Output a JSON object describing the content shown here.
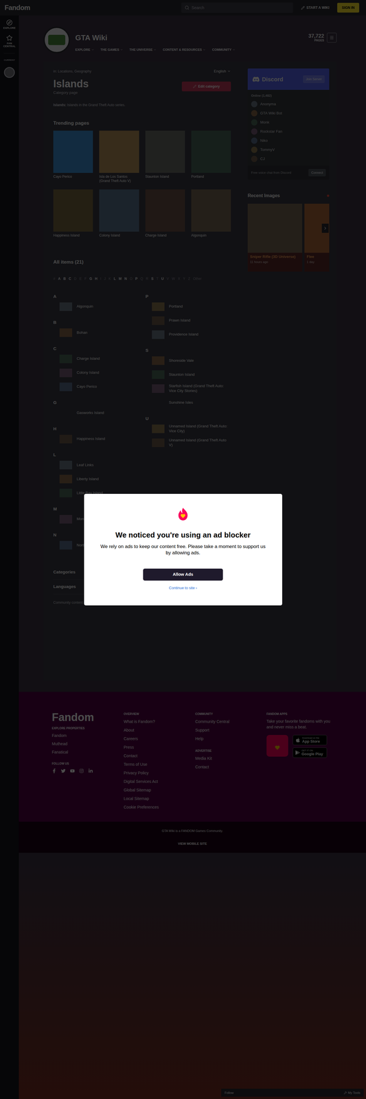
{
  "global_nav": {
    "logo": "Fandom",
    "search_placeholder": "Search",
    "start_wiki": "START A WIKI",
    "sign_in": "SIGN IN"
  },
  "left_rail": {
    "items": [
      "EXPLORE",
      "FAN CENTRAL"
    ],
    "current_label": "CURRENT"
  },
  "wiki": {
    "name": "GTA Wiki",
    "nav": [
      "EXPLORE",
      "THE GAMES",
      "THE UNIVERSE",
      "CONTENT & RESOURCES",
      "COMMUNITY"
    ],
    "pages_count": "37,722",
    "pages_label": "PAGES"
  },
  "page": {
    "breadcrumb": "in: Locations, Geography",
    "language": "English",
    "title": "Islands",
    "subtitle": "Category page",
    "edit_button": "Edit category",
    "description_label": "Islands:",
    "description": "Islands in the Grand Theft Auto series."
  },
  "trending": {
    "title": "Trending pages",
    "items": [
      "Cayo Perico",
      "Isla de Los Santos (Grand Theft Auto V)",
      "Staunton Island",
      "Portland",
      "Happiness Island",
      "Colony Island",
      "Charge Island",
      "Algonquin"
    ]
  },
  "all_items": {
    "title": "All items (21)",
    "alphabet": [
      {
        "letter": "#",
        "has_items": false
      },
      {
        "letter": "A",
        "has_items": true
      },
      {
        "letter": "B",
        "has_items": true
      },
      {
        "letter": "C",
        "has_items": true
      },
      {
        "letter": "D",
        "has_items": false
      },
      {
        "letter": "E",
        "has_items": false
      },
      {
        "letter": "F",
        "has_items": false
      },
      {
        "letter": "G",
        "has_items": true
      },
      {
        "letter": "H",
        "has_items": true
      },
      {
        "letter": "I",
        "has_items": false
      },
      {
        "letter": "J",
        "has_items": false
      },
      {
        "letter": "K",
        "has_items": false
      },
      {
        "letter": "L",
        "has_items": true
      },
      {
        "letter": "M",
        "has_items": true
      },
      {
        "letter": "N",
        "has_items": true
      },
      {
        "letter": "O",
        "has_items": false
      },
      {
        "letter": "P",
        "has_items": true
      },
      {
        "letter": "Q",
        "has_items": false
      },
      {
        "letter": "R",
        "has_items": false
      },
      {
        "letter": "S",
        "has_items": true
      },
      {
        "letter": "T",
        "has_items": false
      },
      {
        "letter": "U",
        "has_items": true
      },
      {
        "letter": "V",
        "has_items": false
      },
      {
        "letter": "W",
        "has_items": false
      },
      {
        "letter": "X",
        "has_items": false
      },
      {
        "letter": "Y",
        "has_items": false
      },
      {
        "letter": "Z",
        "has_items": false
      },
      {
        "letter": "Other",
        "has_items": false
      }
    ],
    "columns": [
      [
        {
          "letter": "A",
          "items": [
            {
              "name": "Algonquin",
              "thumbnail": true
            }
          ]
        },
        {
          "letter": "B",
          "items": [
            {
              "name": "Bohan",
              "thumbnail": true
            }
          ]
        },
        {
          "letter": "C",
          "items": [
            {
              "name": "Charge Island",
              "thumbnail": true
            },
            {
              "name": "Colony Island",
              "thumbnail": true
            },
            {
              "name": "Cayo Perico",
              "thumbnail": true
            }
          ]
        },
        {
          "letter": "G",
          "items": [
            {
              "name": "Gasworks Island",
              "thumbnail": false
            }
          ]
        },
        {
          "letter": "H",
          "items": [
            {
              "name": "Happiness Island",
              "thumbnail": true
            }
          ]
        },
        {
          "letter": "L",
          "items": [
            {
              "name": "Leaf Links",
              "thumbnail": true
            },
            {
              "name": "Liberty Island",
              "thumbnail": true
            },
            {
              "name": "Little Bay Island",
              "thumbnail": true
            }
          ]
        },
        {
          "letter": "M",
          "items": [
            {
              "name": "Monument Island",
              "thumbnail": true
            }
          ]
        },
        {
          "letter": "N",
          "items": [
            {
              "name": "North Point Island",
              "thumbnail": true
            }
          ]
        }
      ],
      [
        {
          "letter": "P",
          "items": [
            {
              "name": "Portland",
              "thumbnail": true
            },
            {
              "name": "Prawn Island",
              "thumbnail": true
            },
            {
              "name": "Providence Island",
              "thumbnail": true
            }
          ]
        },
        {
          "letter": "S",
          "items": [
            {
              "name": "Shoreside Vale",
              "thumbnail": true
            },
            {
              "name": "Staunton Island",
              "thumbnail": true
            },
            {
              "name": "Starfish Island (Grand Theft Auto: Vice City Stories)",
              "thumbnail": true
            },
            {
              "name": "Sunshine Isles",
              "thumbnail": false
            }
          ]
        },
        {
          "letter": "U",
          "items": [
            {
              "name": "Unnamed Island (Grand Theft Auto: Vice City)",
              "thumbnail": true
            },
            {
              "name": "Unnamed Island (Grand Theft Auto V)",
              "thumbnail": true
            }
          ]
        }
      ]
    ]
  },
  "accordions": [
    "Categories",
    "Languages"
  ],
  "license": "Community content is available under CC-BY-SA unless otherwise noted.",
  "discord": {
    "title": "Discord",
    "join": "Join Server",
    "online": "Online (1,482)",
    "members": [
      "Anonyma",
      "GTA Wiki Bot",
      "Monk",
      "Rockstar Fan",
      "Niko",
      "TommyV",
      "CJ"
    ],
    "footer_text": "Free voice chat from Discord",
    "connect": "Connect"
  },
  "recent_images": {
    "title": "Recent Images",
    "cards": [
      {
        "title": "Sniper Rifle (3D Universe)",
        "time": "11 hours ago"
      },
      {
        "title": "Flee",
        "time": "1 day"
      }
    ]
  },
  "footer": {
    "logo": "Fandom",
    "explore_title": "EXPLORE PROPERTIES",
    "properties": [
      "Fandom",
      "Muthead",
      "Fanatical"
    ],
    "follow_title": "FOLLOW US",
    "overview_title": "OVERVIEW",
    "overview": [
      "What is Fandom?",
      "About",
      "Careers",
      "Press",
      "Contact",
      "Terms of Use",
      "Privacy Policy",
      "Digital Services Act",
      "Global Sitemap",
      "Local Sitemap",
      "Cookie Preferences"
    ],
    "community_title": "COMMUNITY",
    "community": [
      "Community Central",
      "Support",
      "Help"
    ],
    "advertise_title": "ADVERTISE",
    "advertise": [
      "Media Kit",
      "Contact"
    ],
    "apps_title": "FANDOM APPS",
    "apps_text": "Take your favorite fandoms with you and never miss a beat.",
    "app_store": {
      "small": "Download on the",
      "big": "App Store"
    },
    "google_play": {
      "small": "GET IT ON",
      "big": "Google Play"
    }
  },
  "bottom_bar": {
    "text": "GTA Wiki is a FANDOM Games Community.",
    "mobile": "VIEW MOBILE SITE"
  },
  "toolbar": [
    "Follow",
    "My Tools"
  ],
  "modal": {
    "title": "We noticed you're using an ad blocker",
    "body": "We rely on ads to keep our content free. Please take a moment to support us by allowing ads.",
    "button": "Allow Ads",
    "link": "Continue to site ›"
  }
}
